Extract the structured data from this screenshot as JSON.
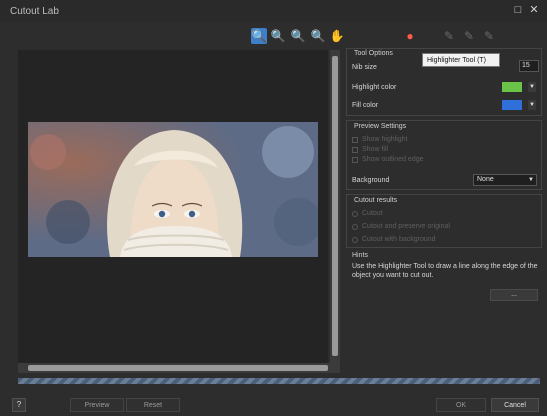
{
  "window": {
    "title": "Cutout Lab",
    "maximize_icon": "maximize-icon",
    "close_icon": "close-icon"
  },
  "toolbar": {
    "items": [
      {
        "icon": "zoom-fit-icon",
        "active": true
      },
      {
        "icon": "zoom-in-icon"
      },
      {
        "icon": "zoom-out-icon"
      },
      {
        "icon": "zoom-actual-icon"
      },
      {
        "icon": "hand-pan-icon"
      },
      {
        "icon": "highlighter-icon",
        "red": true
      },
      {
        "icon": "eraser-icon",
        "dim": true
      },
      {
        "icon": "brush-icon",
        "dim": true
      },
      {
        "icon": "pencil-icon",
        "dim": true
      }
    ],
    "tooltip": "Highlighter Tool (T)"
  },
  "tool_options": {
    "title": "Tool Options",
    "nib_size_label": "Nib size",
    "nib_size_value": "15",
    "highlight_color_label": "Highlight color",
    "highlight_color": "#6bc348",
    "fill_color_label": "Fill color",
    "fill_color": "#2f6fd8"
  },
  "preview_settings": {
    "title": "Preview Settings",
    "options": [
      "Show highlight",
      "Show fill",
      "Show outlined edge"
    ],
    "background_label": "Background",
    "background_value": "None"
  },
  "cutout_results": {
    "title": "Cutout results",
    "options": [
      "Cutout",
      "Cutout and preserve original",
      "Cutout with background"
    ]
  },
  "hints": {
    "title": "Hints",
    "text": "Use the Highlighter Tool to draw a line along the edge of the object you want to cut out.",
    "more_button": "..."
  },
  "footer": {
    "help_label": "?",
    "preview_label": "Preview",
    "reset_label": "Reset",
    "ok_label": "OK",
    "cancel_label": "Cancel"
  },
  "colors": {
    "accent": "#3d7fc8",
    "window_bg": "#2d2d2d"
  }
}
